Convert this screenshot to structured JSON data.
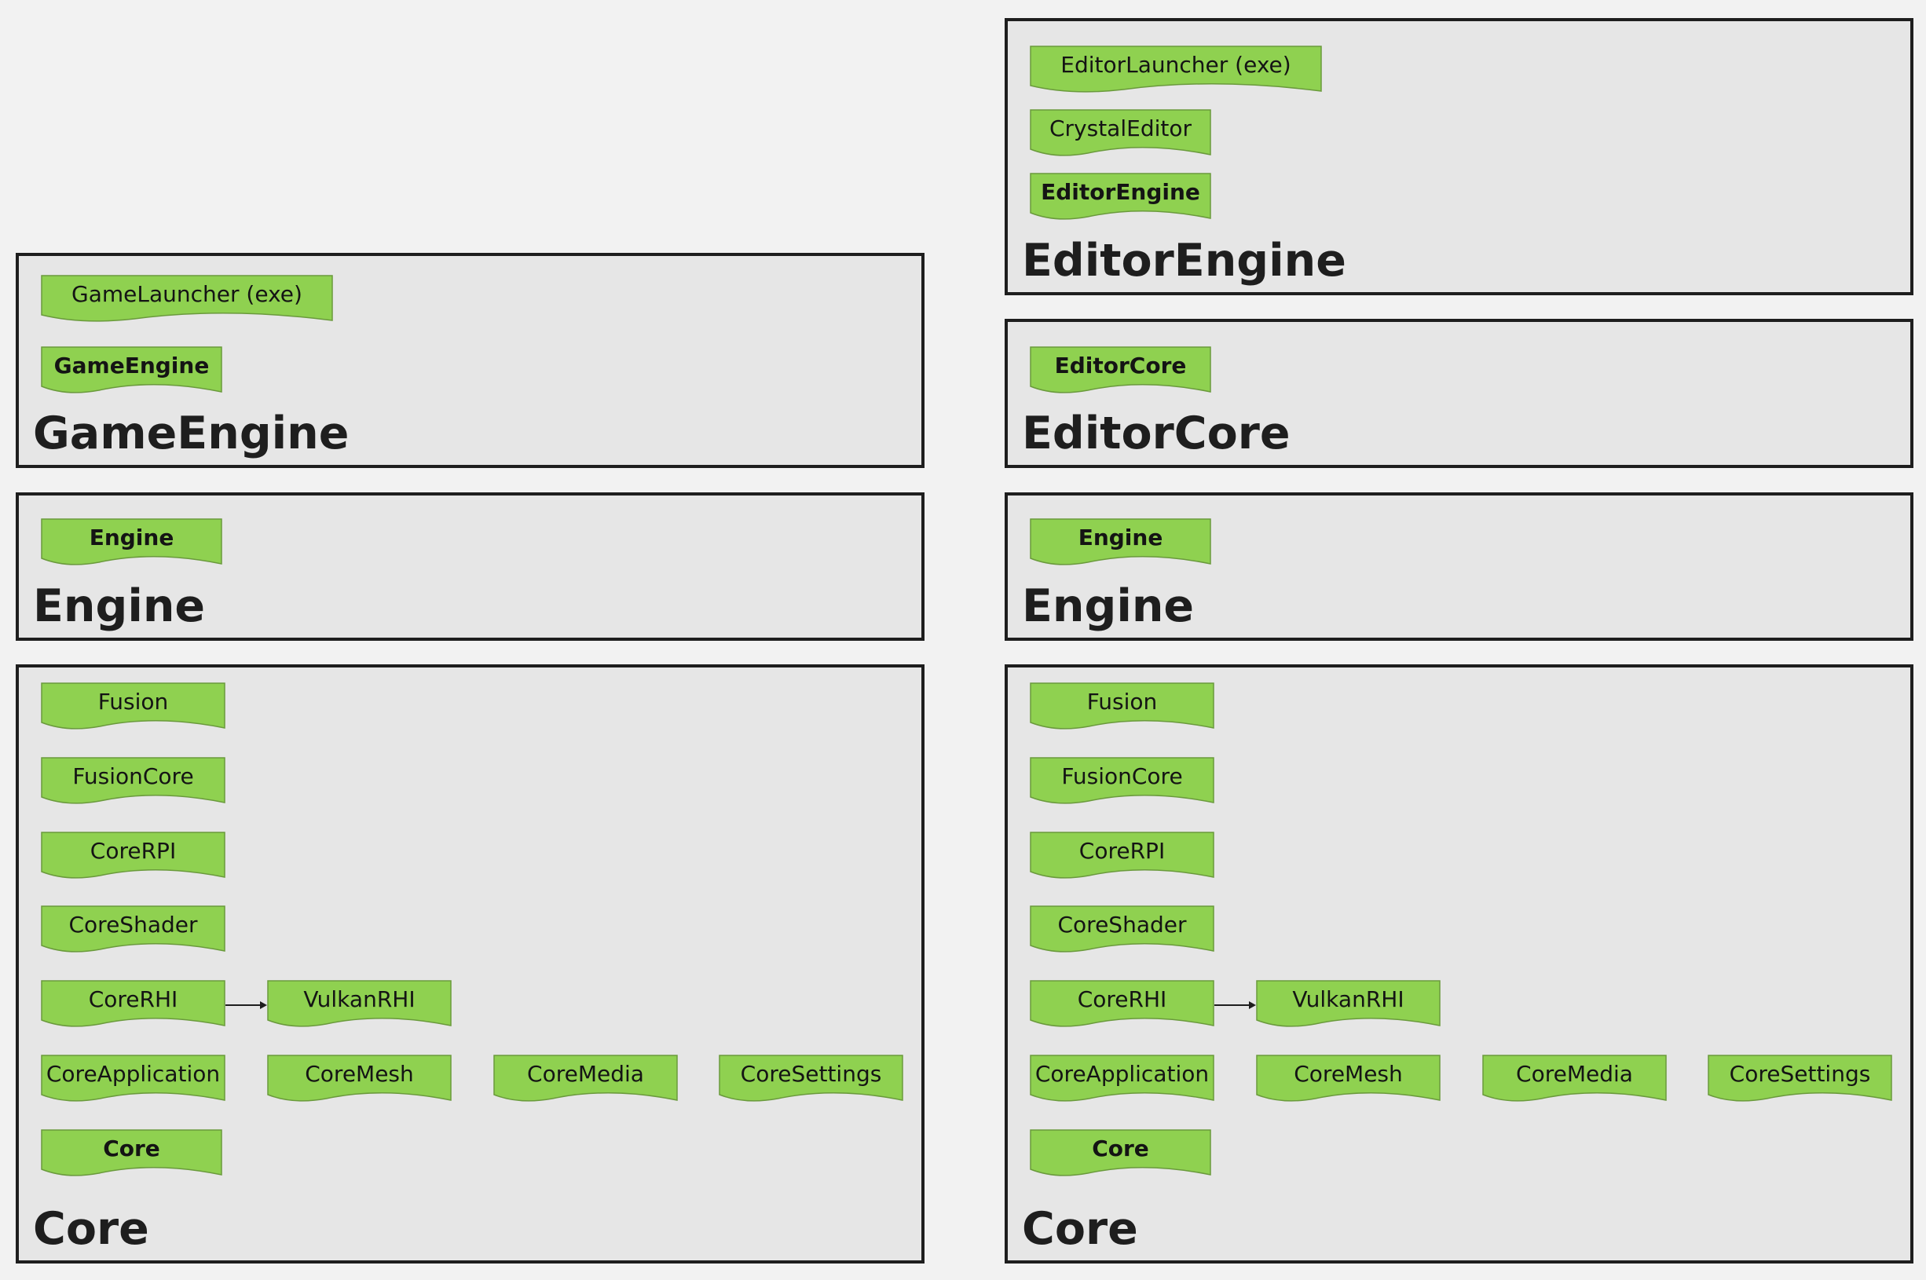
{
  "colors": {
    "module_fill": "#8fd150",
    "module_stroke": "#6a9a3c",
    "frame_fill": "#e6e6e6",
    "frame_border": "#1e1e1e",
    "background": "#f2f2f2"
  },
  "left": {
    "game_engine": {
      "title": "GameEngine",
      "modules": [
        "GameLauncher (exe)",
        "GameEngine"
      ]
    },
    "engine": {
      "title": "Engine",
      "modules": [
        "Engine"
      ]
    },
    "core": {
      "title": "Core",
      "modules": [
        "Fusion",
        "FusionCore",
        "CoreRPI",
        "CoreShader",
        "CoreRHI",
        "VulkanRHI",
        "CoreApplication",
        "CoreMesh",
        "CoreMedia",
        "CoreSettings",
        "Core"
      ]
    }
  },
  "right": {
    "editor_engine": {
      "title": "EditorEngine",
      "modules": [
        "EditorLauncher (exe)",
        "CrystalEditor",
        "EditorEngine"
      ]
    },
    "editor_core": {
      "title": "EditorCore",
      "modules": [
        "EditorCore"
      ]
    },
    "engine": {
      "title": "Engine",
      "modules": [
        "Engine"
      ]
    },
    "core": {
      "title": "Core",
      "modules": [
        "Fusion",
        "FusionCore",
        "CoreRPI",
        "CoreShader",
        "CoreRHI",
        "VulkanRHI",
        "CoreApplication",
        "CoreMesh",
        "CoreMedia",
        "CoreSettings",
        "Core"
      ]
    }
  }
}
